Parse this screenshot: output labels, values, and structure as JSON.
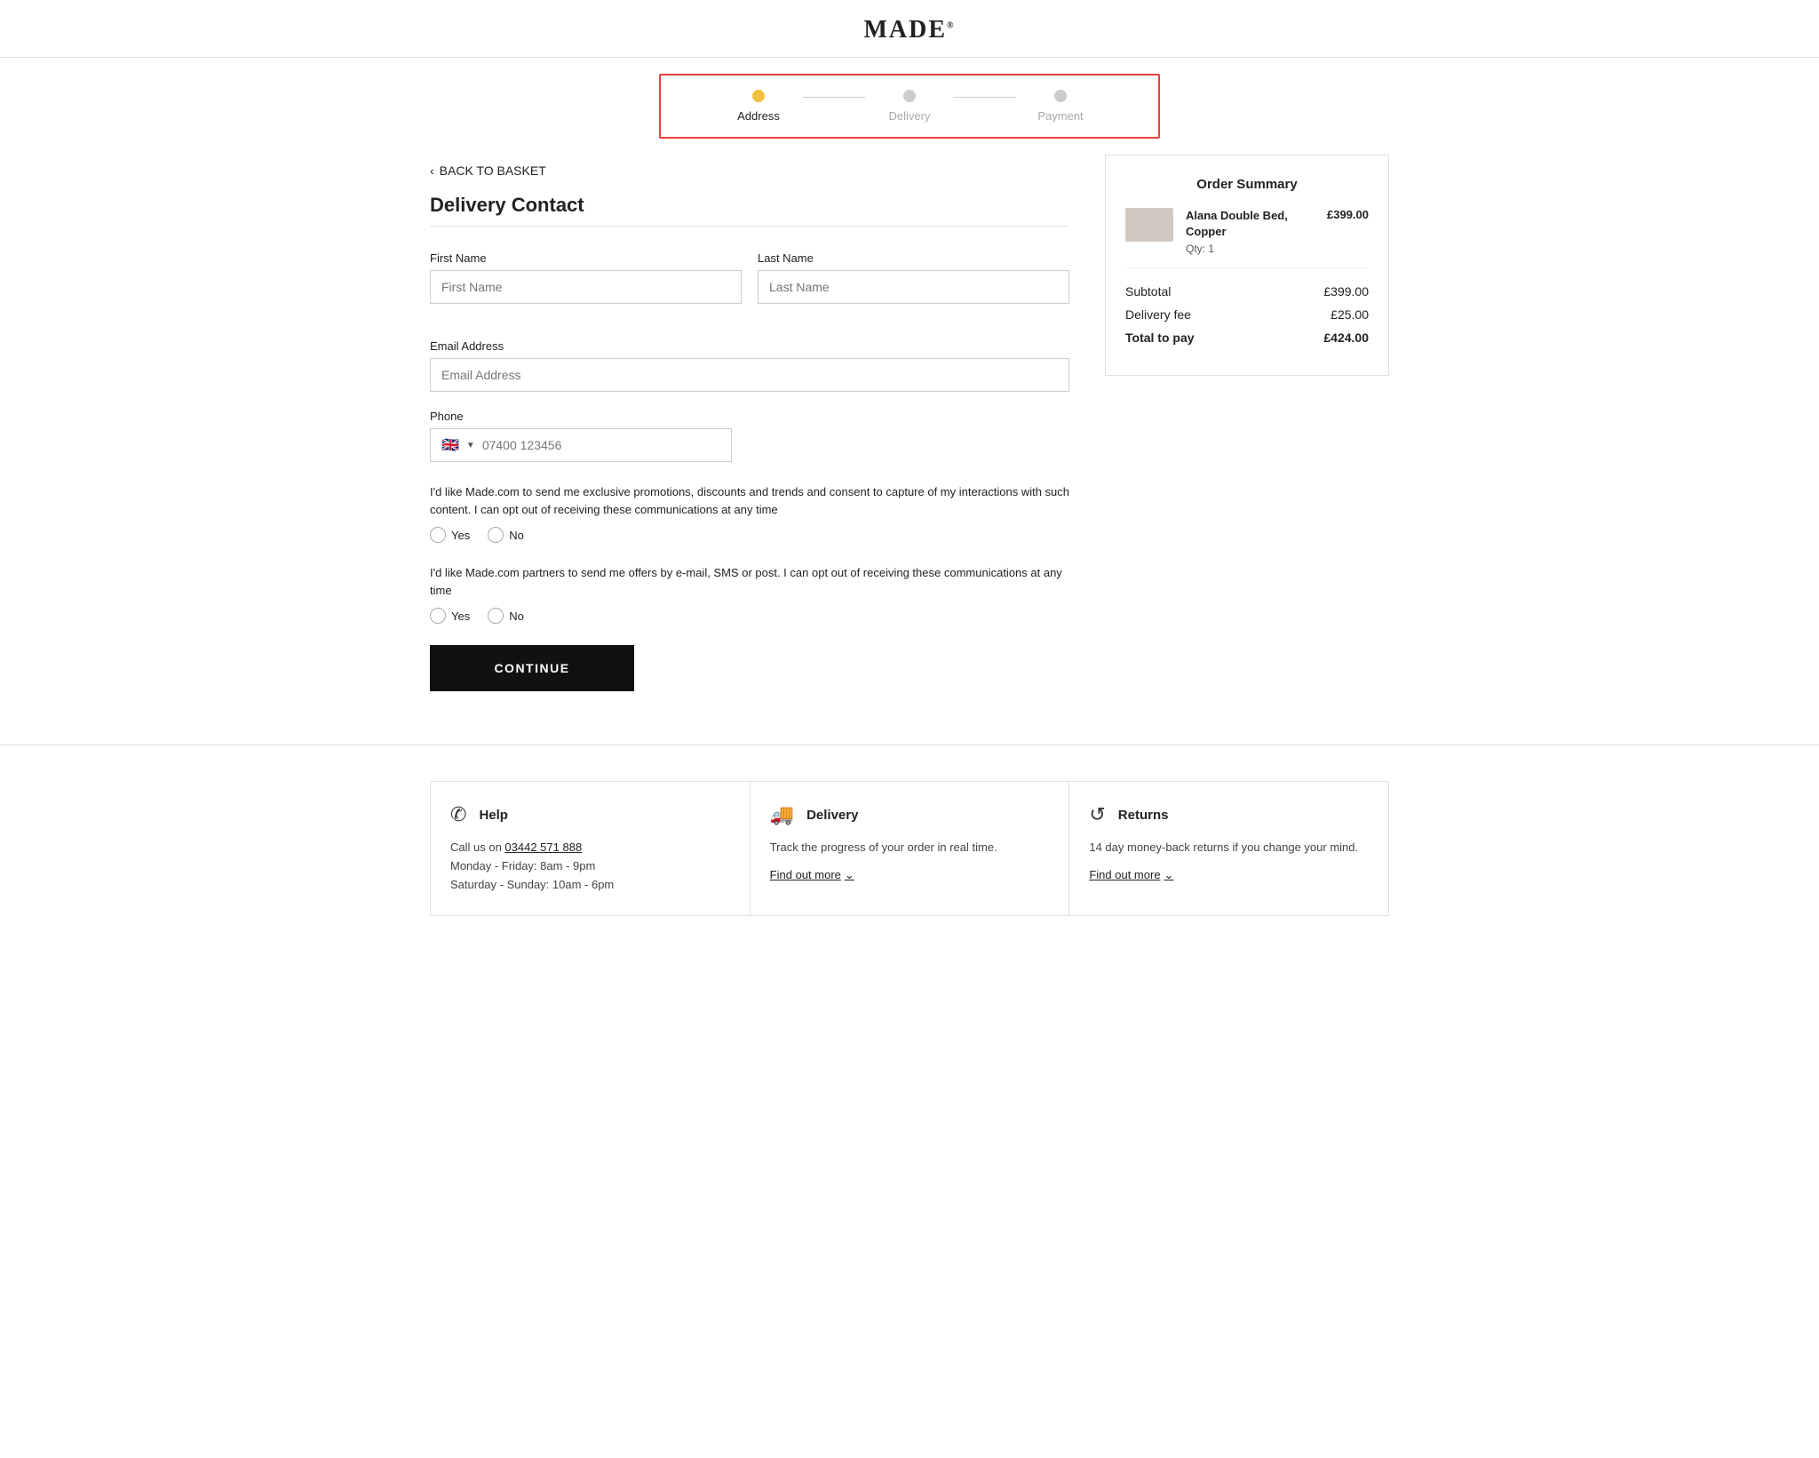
{
  "header": {
    "logo": "MADE",
    "logo_superscript": "®"
  },
  "steps": {
    "items": [
      {
        "label": "Address",
        "state": "active"
      },
      {
        "label": "Delivery",
        "state": "inactive"
      },
      {
        "label": "Payment",
        "state": "inactive"
      }
    ]
  },
  "back_link": "BACK TO BASKET",
  "form": {
    "section_title": "Delivery Contact",
    "first_name_label": "First Name",
    "first_name_placeholder": "First Name",
    "last_name_label": "Last Name",
    "last_name_placeholder": "Last Name",
    "email_label": "Email Address",
    "email_placeholder": "Email Address",
    "phone_label": "Phone",
    "phone_placeholder": "07400 123456",
    "consent1_text": "I'd like Made.com to send me exclusive promotions, discounts and trends and consent to capture of my interactions with such content. I can opt out of receiving these communications at any time",
    "consent2_text": "I'd like Made.com partners to send me offers by e-mail, SMS or post. I can opt out of receiving these communications at any time",
    "yes_label": "Yes",
    "no_label": "No",
    "continue_button": "CONTINUE"
  },
  "order_summary": {
    "title": "Order Summary",
    "item_name": "Alana Double Bed, Copper",
    "item_qty": "Qty: 1",
    "item_price": "£399.00",
    "subtotal_label": "Subtotal",
    "subtotal_value": "£399.00",
    "delivery_label": "Delivery fee",
    "delivery_value": "£25.00",
    "total_label": "Total to pay",
    "total_value": "£424.00"
  },
  "footer": {
    "cards": [
      {
        "icon": "☎",
        "title": "Help",
        "body_line1": "Call us on ",
        "phone": "03442 571 888",
        "body_line2": "Monday - Friday: 8am - 9pm",
        "body_line3": "Saturday - Sunday: 10am - 6pm",
        "find_out_more": null
      },
      {
        "icon": "🚚",
        "title": "Delivery",
        "body_line1": "Track the progress of your order in real time.",
        "find_out_more": "Find out more"
      },
      {
        "icon": "↺",
        "title": "Returns",
        "body_line1": "14 day money-back returns if you change your mind.",
        "find_out_more": "Find out more"
      }
    ]
  }
}
